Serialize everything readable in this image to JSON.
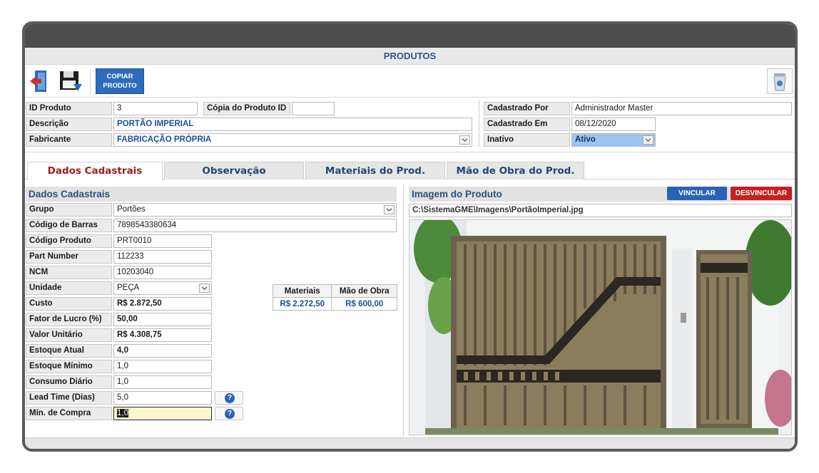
{
  "window": {
    "title": "PRODUTOS"
  },
  "toolbar": {
    "copy_label_line1": "COPIAR",
    "copy_label_line2": "PRODUTO"
  },
  "header_fields": {
    "id_label": "ID Produto",
    "id_value": "3",
    "copy_id_label": "Cópia do Produto ID",
    "copy_id_value": "",
    "desc_label": "Descrição",
    "desc_value": "PORTÃO IMPERIAL",
    "manufacturer_label": "Fabricante",
    "manufacturer_value": "FABRICAÇÃO PRÓPRIA",
    "created_by_label": "Cadastrado Por",
    "created_by_value": "Administrador Master",
    "created_at_label": "Cadastrado Em",
    "created_at_value": "08/12/2020",
    "inactive_label": "Inativo",
    "inactive_value": "Ativo"
  },
  "tabs": [
    {
      "label": "Dados Cadastrais",
      "active": true
    },
    {
      "label": "Observação"
    },
    {
      "label": "Materiais do Prod."
    },
    {
      "label": "Mão de Obra do Prod."
    }
  ],
  "details": {
    "section_title": "Dados Cadastrais",
    "group_label": "Grupo",
    "group_value": "Portões",
    "barcode_label": "Código de Barras",
    "barcode_value": "7898543380634",
    "code_label": "Código Produto",
    "code_value": "PRT0010",
    "part_label": "Part Number",
    "part_value": "112233",
    "ncm_label": "NCM",
    "ncm_value": "10203040",
    "unit_label": "Unidade",
    "unit_value": "PEÇA",
    "cost_label": "Custo",
    "cost_value": "R$ 2.872,50",
    "profit_label": "Fator de Lucro (%)",
    "profit_value": "50,00",
    "unit_price_label": "Valor Unitário",
    "unit_price_value": "R$ 4.308,75",
    "stock_label": "Estoque Atual",
    "stock_value": "4,0",
    "min_stock_label": "Estoque Mínimo",
    "min_stock_value": "1,0",
    "daily_label": "Consumo Diário",
    "daily_value": "1,0",
    "lead_label": "Lead Time (Dias)",
    "lead_value": "5,0",
    "min_buy_label": "Mín. de Compra",
    "min_buy_value": "1,0",
    "help_glyph": "?"
  },
  "cost_breakdown": {
    "materials_header": "Materiais",
    "labor_header": "Mão de Obra",
    "materials_value": "R$ 2.272,50",
    "labor_value": "R$ 600,00"
  },
  "image_panel": {
    "title": "Imagem do Produto",
    "link_label": "VINCULAR",
    "unlink_label": "DESVINCULAR",
    "path": "C:\\SistemaGME\\Imagens\\PortãoImperial.jpg"
  },
  "colors": {
    "accent_blue": "#2c62b3",
    "danger_red": "#c62121",
    "active_tab_text": "#9c1c1c"
  }
}
